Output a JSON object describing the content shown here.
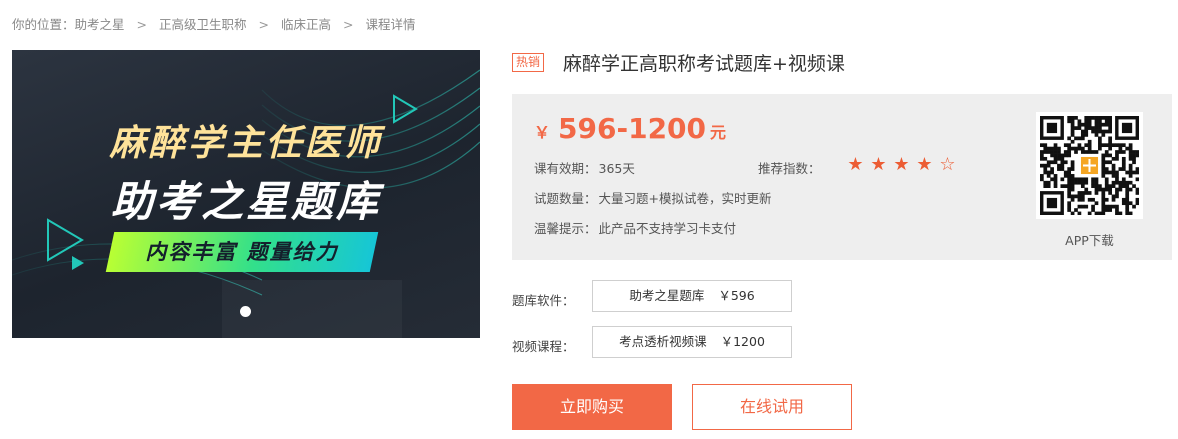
{
  "breadcrumb": {
    "prefix": "你的位置：",
    "items": [
      "助考之星",
      "正高级卫生职称",
      "临床正高",
      "课程详情"
    ],
    "separator": ">"
  },
  "banner": {
    "line1": "麻醉学主任医师",
    "line2": "助考之星题库",
    "line3": "内容丰富 题量给力",
    "colors": {
      "line1": "#ffe39a",
      "ribbon_start": "#b9ff33",
      "ribbon_end": "#16c6d6",
      "play_icon": "#22c7b8"
    }
  },
  "product": {
    "badge": "热销",
    "title": "麻醉学正高职称考试题库+视频课"
  },
  "price": {
    "symbol": "￥",
    "range": "596-1200",
    "unit": "元",
    "color": "#f26846"
  },
  "details": {
    "validity_label": "课有效期：",
    "validity_value": "365天",
    "rating_label": "推荐指数：",
    "rating": 4,
    "rating_max": 5,
    "questions_label": "试题数量：",
    "questions_value": "大量习题+模拟试卷，实时更新",
    "tip_label": "温馨提示：",
    "tip_value": "此产品不支持学习卡支付"
  },
  "app": {
    "download_label": "APP下载",
    "qr_icon": "qr-code-icon"
  },
  "options": {
    "software_label": "题库软件：",
    "software_name": "助考之星题库",
    "software_price": "￥596",
    "video_label": "视频课程：",
    "video_name": "考点透析视频课",
    "video_price": "￥1200"
  },
  "actions": {
    "buy": "立即购买",
    "trial": "在线试用",
    "accent": "#f26846"
  }
}
